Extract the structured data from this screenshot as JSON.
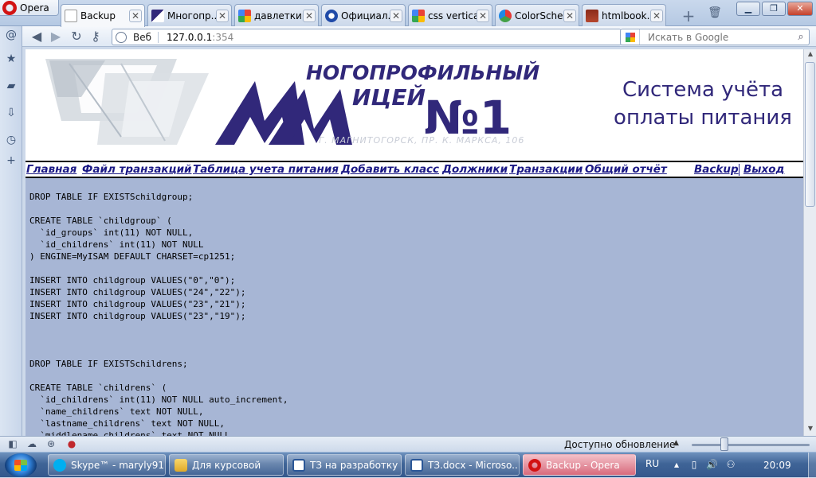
{
  "browser": {
    "menu_label": "Opera",
    "tabs": [
      {
        "label": "Backup",
        "active": true,
        "icon": "page-icon"
      },
      {
        "label": "Многопр...",
        "icon": "lyceum-icon"
      },
      {
        "label": "давлеткир...",
        "icon": "google-icon"
      },
      {
        "label": "Официал...",
        "icon": "opera-link-icon"
      },
      {
        "label": "css vertica...",
        "icon": "google-icon"
      },
      {
        "label": "ColorSche...",
        "icon": "colorscheme-icon"
      },
      {
        "label": "htmlbook....",
        "icon": "htmlbook-icon"
      }
    ],
    "address": {
      "mode_label": "Веб",
      "url_host": "127.0.0.1",
      "url_port": ":354"
    },
    "search": {
      "placeholder": "Искать в Google"
    },
    "status": {
      "update_text": "Доступно обновление"
    }
  },
  "site": {
    "logo": {
      "line1": "НОГОПРОФИЛЬНЫЙ",
      "line2": "ИЦЕЙ",
      "number": "№1",
      "address": "Г. МАГНИТОГОРСК, ПР. К. МАРКСА, 106"
    },
    "title_line1": "Система учёта",
    "title_line2": "оплаты питания",
    "menu": [
      "Главная",
      "Файл транзакций",
      "Таблица учета питания",
      "Добавить класс",
      "Должники",
      "Транзакции",
      "Общий отчёт",
      "Backup",
      "Выход"
    ],
    "sql_lines": [
      "DROP TABLE IF EXISTSchildgroup;",
      "",
      "CREATE TABLE `childgroup` (",
      "  `id_groups` int(11) NOT NULL,",
      "  `id_childrens` int(11) NOT NULL",
      ") ENGINE=MyISAM DEFAULT CHARSET=cp1251;",
      "",
      "INSERT INTO childgroup VALUES(\"0\",\"0\");",
      "INSERT INTO childgroup VALUES(\"24\",\"22\");",
      "INSERT INTO childgroup VALUES(\"23\",\"21\");",
      "INSERT INTO childgroup VALUES(\"23\",\"19\");",
      "",
      "",
      "",
      "DROP TABLE IF EXISTSchildrens;",
      "",
      "CREATE TABLE `childrens` (",
      "  `id_childrens` int(11) NOT NULL auto_increment,",
      "  `name_childrens` text NOT NULL,",
      "  `lastname_childrens` text NOT NULL,",
      "  `middlename_childrens` text NOT NULL,"
    ]
  },
  "taskbar": {
    "items": [
      {
        "label": "Skype™ - maryly91",
        "icon": "skype-icon"
      },
      {
        "label": "Для курсовой",
        "icon": "folder-icon"
      },
      {
        "label": "ТЗ на разработку ...",
        "icon": "word-icon"
      },
      {
        "label": "ТЗ.docx - Microso...",
        "icon": "word-icon"
      },
      {
        "label": "Backup - Opera",
        "icon": "opera-icon",
        "active": true
      }
    ],
    "language": "RU",
    "clock": "20:09"
  },
  "colors": {
    "brand_purple": "#31287a",
    "menu_link": "#1b1985",
    "content_bg": "#a7b6d5"
  }
}
